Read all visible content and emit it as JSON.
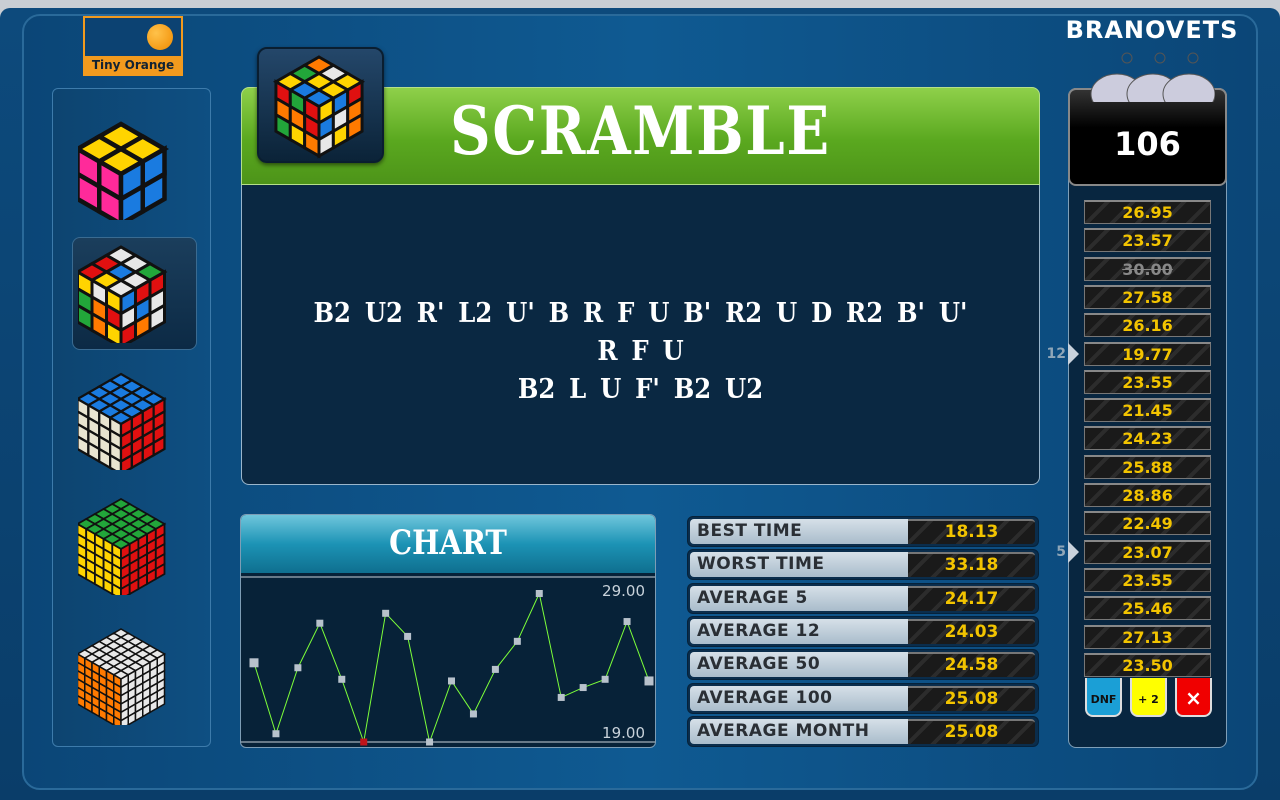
{
  "logo": {
    "text": "Tiny Orange"
  },
  "brand": {
    "text": "BRANOVETS"
  },
  "sidebar": {
    "items": [
      {
        "name": "2x2",
        "size": 2,
        "selected": false
      },
      {
        "name": "3x3",
        "size": 3,
        "selected": true
      },
      {
        "name": "4x4",
        "size": 4,
        "selected": false
      },
      {
        "name": "5x5",
        "size": 5,
        "selected": false
      },
      {
        "name": "6x6",
        "size": 6,
        "selected": false
      }
    ]
  },
  "scramble": {
    "title": "SCRAMBLE",
    "line1": "B2 U2 R' L2 U' B R F U B' R2 U D R2 B' U' R F U",
    "line2": "B2 L U F' B2 U2"
  },
  "counter": {
    "value": "106"
  },
  "times": [
    "26.95",
    "23.57",
    "30.00",
    "27.58",
    "26.16",
    "19.77",
    "23.55",
    "21.45",
    "24.23",
    "25.88",
    "28.86",
    "22.49",
    "23.07",
    "23.55",
    "25.46",
    "27.13",
    "23.50"
  ],
  "dnf_index": 2,
  "markers": [
    {
      "label": "12",
      "row": 5
    },
    {
      "label": "5",
      "row": 12
    }
  ],
  "buttons": {
    "dnf": "DNF",
    "plus2": "+ 2",
    "delete": "×"
  },
  "stats": [
    {
      "label": "BEST TIME",
      "value": "18.13"
    },
    {
      "label": "WORST TIME",
      "value": "33.18"
    },
    {
      "label": "AVERAGE 5",
      "value": "24.17"
    },
    {
      "label": "AVERAGE 12",
      "value": "24.03"
    },
    {
      "label": "AVERAGE 50",
      "value": "24.58"
    },
    {
      "label": "AVERAGE 100",
      "value": "25.08"
    },
    {
      "label": "AVERAGE MONTH",
      "value": "25.08"
    }
  ],
  "colors": {
    "line": "#7cff3a",
    "best_point": "#c0141a",
    "point": "#b8c2cc",
    "green_header": "#5aa81f",
    "time_text": "#f3c400"
  },
  "chart_data": {
    "type": "line",
    "title": "CHART",
    "ymax_label": "29.00",
    "ymin_label": "19.00",
    "ylim": [
      19,
      29
    ],
    "values": [
      23.8,
      19.5,
      23.5,
      26.2,
      22.8,
      18.9,
      26.8,
      25.4,
      18.9,
      22.7,
      20.7,
      23.4,
      25.1,
      28.0,
      21.7,
      22.3,
      22.8,
      26.3,
      22.7
    ],
    "best_index": 5
  }
}
